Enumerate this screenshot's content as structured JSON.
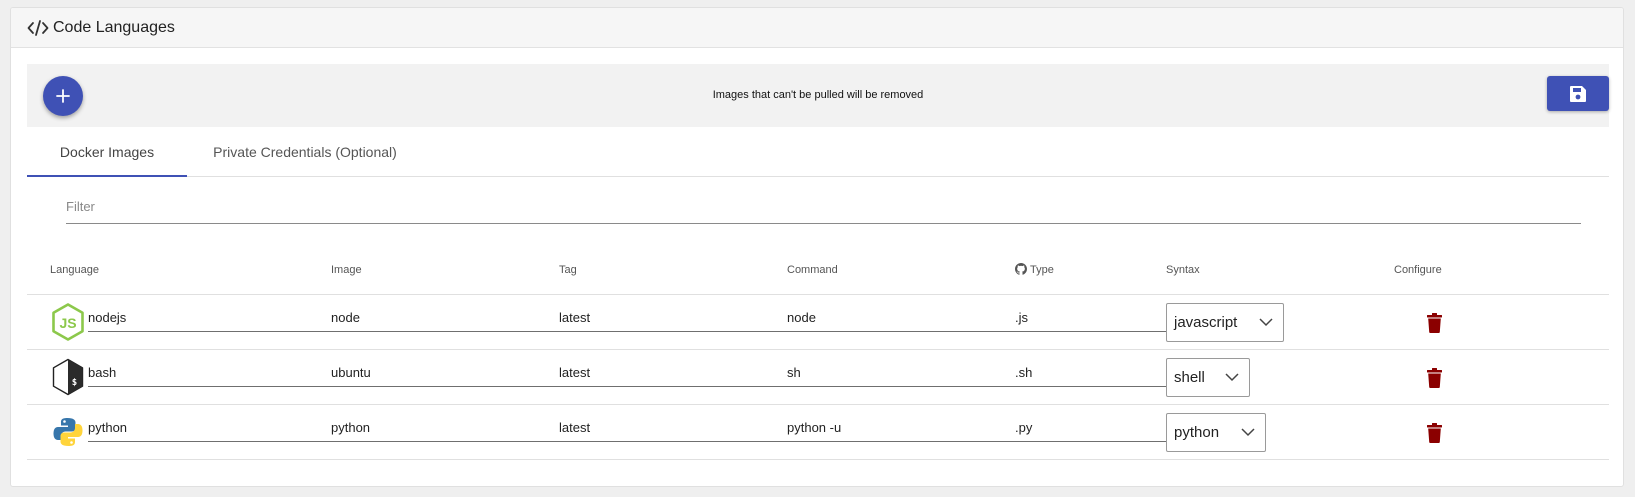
{
  "header": {
    "title": "Code Languages",
    "icon": "code-icon"
  },
  "toolbar": {
    "add_icon": "plus-icon",
    "message": "Images that can't be pulled will be removed",
    "save_icon": "floppy-disk-icon"
  },
  "tabs": [
    {
      "label": "Docker Images",
      "active": true
    },
    {
      "label": "Private Credentials (Optional)",
      "active": false
    }
  ],
  "filter": {
    "placeholder": "Filter",
    "value": ""
  },
  "table": {
    "columns": {
      "language": "Language",
      "image": "Image",
      "tag": "Tag",
      "command": "Command",
      "type": "Type",
      "syntax": "Syntax",
      "configure": "Configure"
    },
    "rows": [
      {
        "icon": "nodejs-logo-icon",
        "language": "nodejs",
        "image": "node",
        "tag": "latest",
        "command": "node",
        "type": ".js",
        "syntax": "javascript"
      },
      {
        "icon": "bash-logo-icon",
        "language": "bash",
        "image": "ubuntu",
        "tag": "latest",
        "command": "sh",
        "type": ".sh",
        "syntax": "shell"
      },
      {
        "icon": "python-logo-icon",
        "language": "python",
        "image": "python",
        "tag": "latest",
        "command": "python -u",
        "type": ".py",
        "syntax": "python"
      }
    ]
  },
  "colors": {
    "primary": "#3f51b5",
    "danger": "#8b0000",
    "nodejs": "#8cc84b",
    "python_blue": "#3776ab",
    "python_yellow": "#ffd43b"
  }
}
